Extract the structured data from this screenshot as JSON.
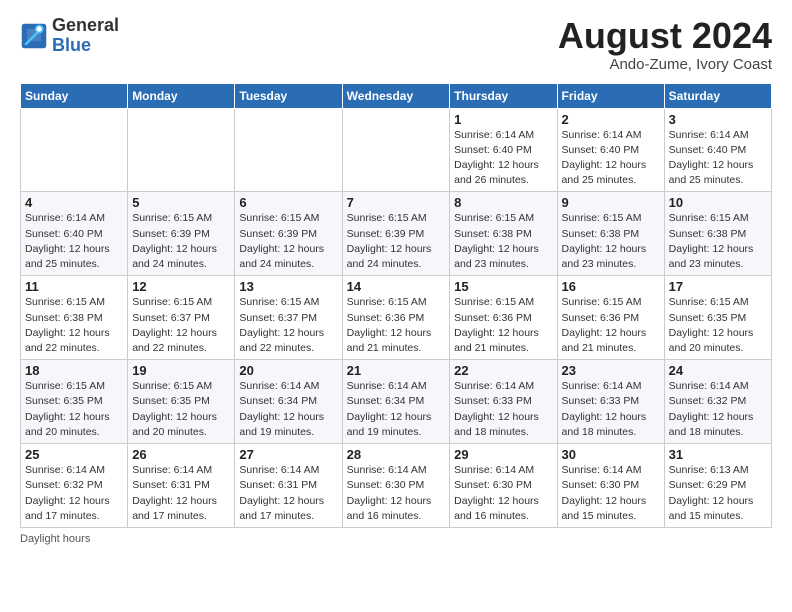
{
  "header": {
    "logo_general": "General",
    "logo_blue": "Blue",
    "title": "August 2024",
    "location": "Ando-Zume, Ivory Coast"
  },
  "weekdays": [
    "Sunday",
    "Monday",
    "Tuesday",
    "Wednesday",
    "Thursday",
    "Friday",
    "Saturday"
  ],
  "weeks": [
    [
      {
        "day": "",
        "info": ""
      },
      {
        "day": "",
        "info": ""
      },
      {
        "day": "",
        "info": ""
      },
      {
        "day": "",
        "info": ""
      },
      {
        "day": "1",
        "info": "Sunrise: 6:14 AM\nSunset: 6:40 PM\nDaylight: 12 hours\nand 26 minutes."
      },
      {
        "day": "2",
        "info": "Sunrise: 6:14 AM\nSunset: 6:40 PM\nDaylight: 12 hours\nand 25 minutes."
      },
      {
        "day": "3",
        "info": "Sunrise: 6:14 AM\nSunset: 6:40 PM\nDaylight: 12 hours\nand 25 minutes."
      }
    ],
    [
      {
        "day": "4",
        "info": "Sunrise: 6:14 AM\nSunset: 6:40 PM\nDaylight: 12 hours\nand 25 minutes."
      },
      {
        "day": "5",
        "info": "Sunrise: 6:15 AM\nSunset: 6:39 PM\nDaylight: 12 hours\nand 24 minutes."
      },
      {
        "day": "6",
        "info": "Sunrise: 6:15 AM\nSunset: 6:39 PM\nDaylight: 12 hours\nand 24 minutes."
      },
      {
        "day": "7",
        "info": "Sunrise: 6:15 AM\nSunset: 6:39 PM\nDaylight: 12 hours\nand 24 minutes."
      },
      {
        "day": "8",
        "info": "Sunrise: 6:15 AM\nSunset: 6:38 PM\nDaylight: 12 hours\nand 23 minutes."
      },
      {
        "day": "9",
        "info": "Sunrise: 6:15 AM\nSunset: 6:38 PM\nDaylight: 12 hours\nand 23 minutes."
      },
      {
        "day": "10",
        "info": "Sunrise: 6:15 AM\nSunset: 6:38 PM\nDaylight: 12 hours\nand 23 minutes."
      }
    ],
    [
      {
        "day": "11",
        "info": "Sunrise: 6:15 AM\nSunset: 6:38 PM\nDaylight: 12 hours\nand 22 minutes."
      },
      {
        "day": "12",
        "info": "Sunrise: 6:15 AM\nSunset: 6:37 PM\nDaylight: 12 hours\nand 22 minutes."
      },
      {
        "day": "13",
        "info": "Sunrise: 6:15 AM\nSunset: 6:37 PM\nDaylight: 12 hours\nand 22 minutes."
      },
      {
        "day": "14",
        "info": "Sunrise: 6:15 AM\nSunset: 6:36 PM\nDaylight: 12 hours\nand 21 minutes."
      },
      {
        "day": "15",
        "info": "Sunrise: 6:15 AM\nSunset: 6:36 PM\nDaylight: 12 hours\nand 21 minutes."
      },
      {
        "day": "16",
        "info": "Sunrise: 6:15 AM\nSunset: 6:36 PM\nDaylight: 12 hours\nand 21 minutes."
      },
      {
        "day": "17",
        "info": "Sunrise: 6:15 AM\nSunset: 6:35 PM\nDaylight: 12 hours\nand 20 minutes."
      }
    ],
    [
      {
        "day": "18",
        "info": "Sunrise: 6:15 AM\nSunset: 6:35 PM\nDaylight: 12 hours\nand 20 minutes."
      },
      {
        "day": "19",
        "info": "Sunrise: 6:15 AM\nSunset: 6:35 PM\nDaylight: 12 hours\nand 20 minutes."
      },
      {
        "day": "20",
        "info": "Sunrise: 6:14 AM\nSunset: 6:34 PM\nDaylight: 12 hours\nand 19 minutes."
      },
      {
        "day": "21",
        "info": "Sunrise: 6:14 AM\nSunset: 6:34 PM\nDaylight: 12 hours\nand 19 minutes."
      },
      {
        "day": "22",
        "info": "Sunrise: 6:14 AM\nSunset: 6:33 PM\nDaylight: 12 hours\nand 18 minutes."
      },
      {
        "day": "23",
        "info": "Sunrise: 6:14 AM\nSunset: 6:33 PM\nDaylight: 12 hours\nand 18 minutes."
      },
      {
        "day": "24",
        "info": "Sunrise: 6:14 AM\nSunset: 6:32 PM\nDaylight: 12 hours\nand 18 minutes."
      }
    ],
    [
      {
        "day": "25",
        "info": "Sunrise: 6:14 AM\nSunset: 6:32 PM\nDaylight: 12 hours\nand 17 minutes."
      },
      {
        "day": "26",
        "info": "Sunrise: 6:14 AM\nSunset: 6:31 PM\nDaylight: 12 hours\nand 17 minutes."
      },
      {
        "day": "27",
        "info": "Sunrise: 6:14 AM\nSunset: 6:31 PM\nDaylight: 12 hours\nand 17 minutes."
      },
      {
        "day": "28",
        "info": "Sunrise: 6:14 AM\nSunset: 6:30 PM\nDaylight: 12 hours\nand 16 minutes."
      },
      {
        "day": "29",
        "info": "Sunrise: 6:14 AM\nSunset: 6:30 PM\nDaylight: 12 hours\nand 16 minutes."
      },
      {
        "day": "30",
        "info": "Sunrise: 6:14 AM\nSunset: 6:30 PM\nDaylight: 12 hours\nand 15 minutes."
      },
      {
        "day": "31",
        "info": "Sunrise: 6:13 AM\nSunset: 6:29 PM\nDaylight: 12 hours\nand 15 minutes."
      }
    ]
  ],
  "footer": "Daylight hours"
}
